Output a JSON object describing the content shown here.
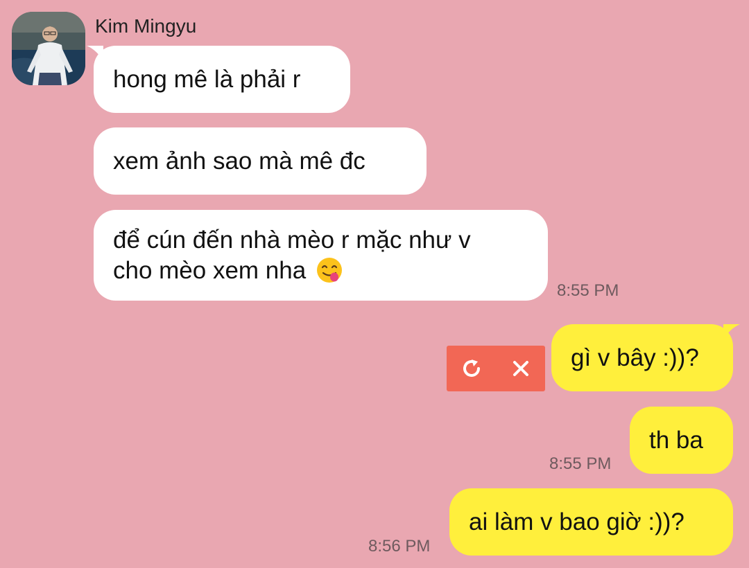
{
  "contact": {
    "name": "Kim Mingyu",
    "avatar_icon": "profile-photo"
  },
  "messages": [
    {
      "direction": "incoming",
      "text": "hong mê là phải r"
    },
    {
      "direction": "incoming",
      "text": "xem ảnh sao mà mê đc"
    },
    {
      "direction": "incoming",
      "lines": [
        "để cún đến nhà mèo r mặc như v",
        "cho mèo xem nha"
      ],
      "emoji": "face-savoring-food-emoji",
      "time": "8:55 PM"
    },
    {
      "direction": "outgoing",
      "text": "gì v bây :))?",
      "status": "failed"
    },
    {
      "direction": "outgoing",
      "text": "th ba",
      "time": "8:55 PM"
    },
    {
      "direction": "outgoing",
      "text": "ai làm v bao giờ :))?",
      "time": "8:56 PM"
    }
  ],
  "failed_actions": {
    "retry_icon": "retry-icon",
    "delete_icon": "close-icon"
  },
  "colors": {
    "background": "#E9A7B1",
    "incoming_bubble": "#FFFFFF",
    "outgoing_bubble": "#FFEF3C",
    "failed_actions": "#F26755",
    "timestamp": "#6E5A5E"
  }
}
